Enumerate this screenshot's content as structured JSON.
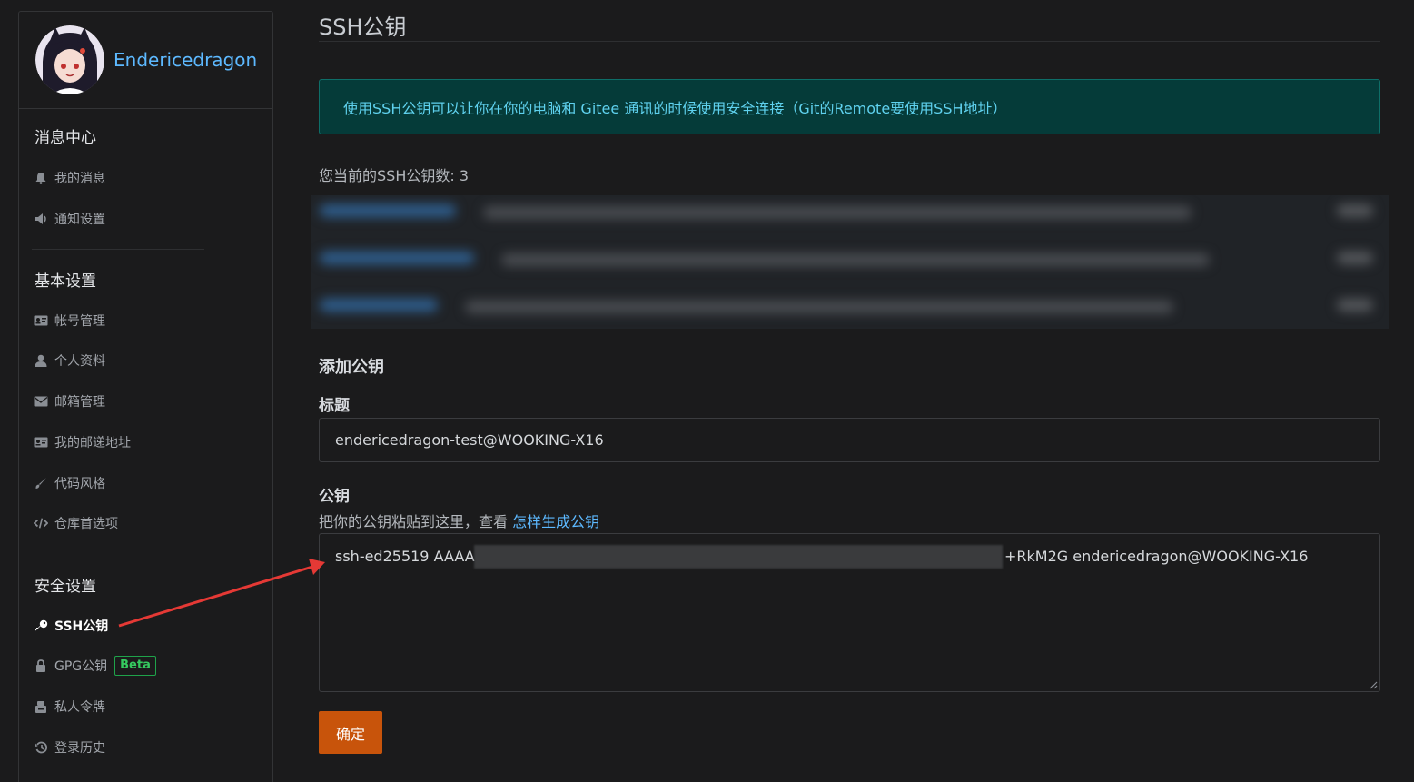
{
  "user": {
    "name": "Endericedragon"
  },
  "sidebar": {
    "sections": [
      {
        "title": "消息中心",
        "items": [
          {
            "label": "我的消息",
            "icon": "bell-icon"
          },
          {
            "label": "通知设置",
            "icon": "megaphone-icon"
          }
        ]
      },
      {
        "title": "基本设置",
        "items": [
          {
            "label": "帐号管理",
            "icon": "id-card-icon"
          },
          {
            "label": "个人资料",
            "icon": "user-icon"
          },
          {
            "label": "邮箱管理",
            "icon": "envelope-icon"
          },
          {
            "label": "我的邮递地址",
            "icon": "address-card-icon"
          },
          {
            "label": "代码风格",
            "icon": "brush-icon"
          },
          {
            "label": "仓库首选项",
            "icon": "code-icon"
          }
        ]
      },
      {
        "title": "安全设置",
        "items": [
          {
            "label": "SSH公钥",
            "icon": "key-icon",
            "active": true
          },
          {
            "label": "GPG公钥",
            "icon": "lock-icon",
            "badge": "Beta"
          },
          {
            "label": "私人令牌",
            "icon": "token-icon"
          },
          {
            "label": "登录历史",
            "icon": "history-icon"
          }
        ]
      }
    ]
  },
  "main": {
    "title": "SSH公钥",
    "alert": "使用SSH公钥可以让你在你的电脑和 Gitee 通讯的时候使用安全连接（Git的Remote要使用SSH地址）",
    "key_count_label": "您当前的SSH公钥数: 3",
    "add_section_title": "添加公钥",
    "title_label": "标题",
    "title_value": "endericedragon-test@WOOKING-X16",
    "key_label": "公钥",
    "key_hint": "把你的公钥粘贴到这里，查看 ",
    "key_hint_link": "怎样生成公钥",
    "key_value_start": "ssh-ed25519 AAAA(",
    "key_value_end": "+RkM2G endericedragon@WOOKING-X16",
    "submit_label": "确定"
  },
  "colors": {
    "accent_link": "#5db9ff",
    "submit_bg": "#c8540b",
    "alert_bg": "#053b39",
    "beta_green": "#35c95f",
    "arrow_red": "#e53935"
  }
}
